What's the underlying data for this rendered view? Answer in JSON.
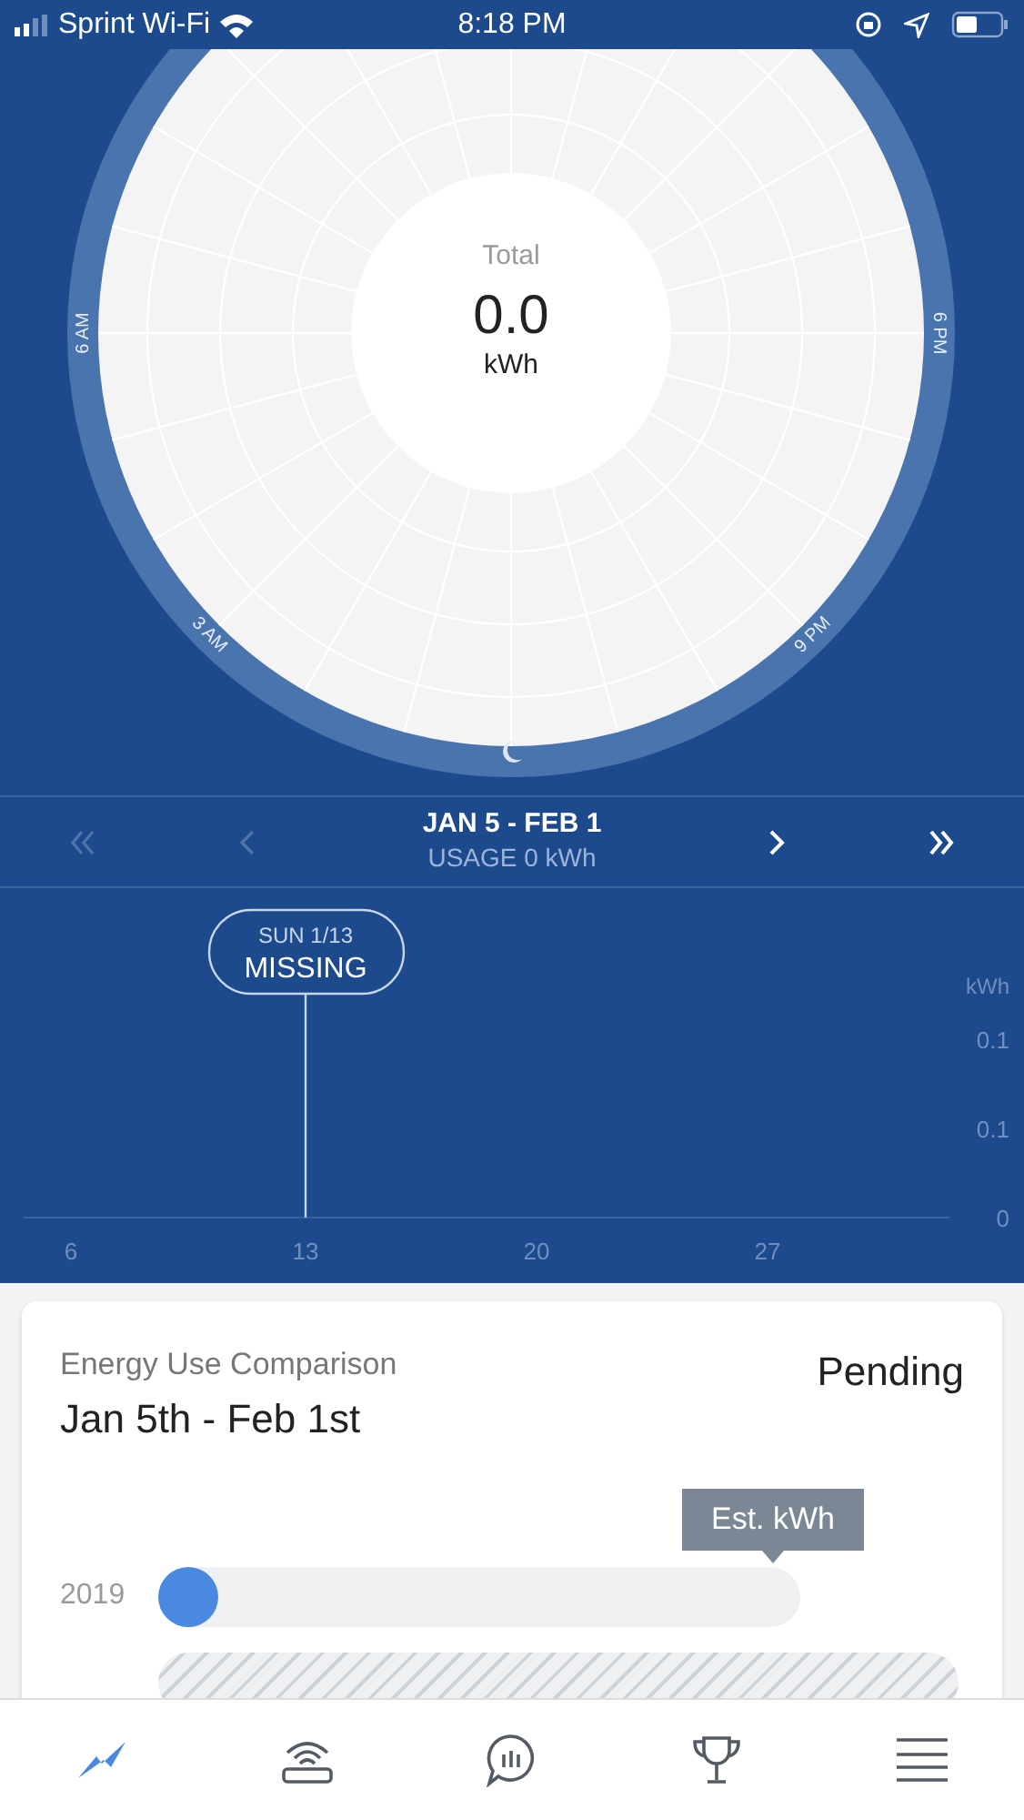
{
  "status_bar": {
    "carrier": "Sprint Wi-Fi",
    "time": "8:18 PM"
  },
  "clock": {
    "total_label": "Total",
    "total_value": "0.0",
    "unit": "kWh",
    "hour_labels": [
      "6 AM",
      "6 PM",
      "3 AM",
      "9 PM"
    ]
  },
  "period_nav": {
    "range": "JAN 5 - FEB 1",
    "usage": "USAGE 0 kWh",
    "buttons": [
      {
        "kind": "first",
        "disabled": true
      },
      {
        "kind": "prev",
        "disabled": true
      },
      {
        "kind": "next",
        "disabled": false
      },
      {
        "kind": "last",
        "disabled": false
      }
    ]
  },
  "daily_chart": {
    "unit": "kWh",
    "y_labels": [
      "0.1",
      "0.1",
      "0"
    ],
    "x_labels": [
      "6",
      "13",
      "20",
      "27"
    ],
    "marker": {
      "day": "SUN 1/13",
      "status": "MISSING"
    }
  },
  "comparison_card": {
    "title": "Energy Use Comparison",
    "range": "Jan 5th - Feb 1st",
    "status": "Pending",
    "tooltip": "Est. kWh",
    "rows": [
      {
        "kind": "bar",
        "year": "2019",
        "level": 0
      },
      {
        "kind": "hatched"
      }
    ]
  },
  "tab_bar": [
    {
      "selected": true
    },
    {
      "selected": false
    },
    {
      "selected": false
    },
    {
      "selected": false
    },
    {
      "selected": false
    }
  ]
}
